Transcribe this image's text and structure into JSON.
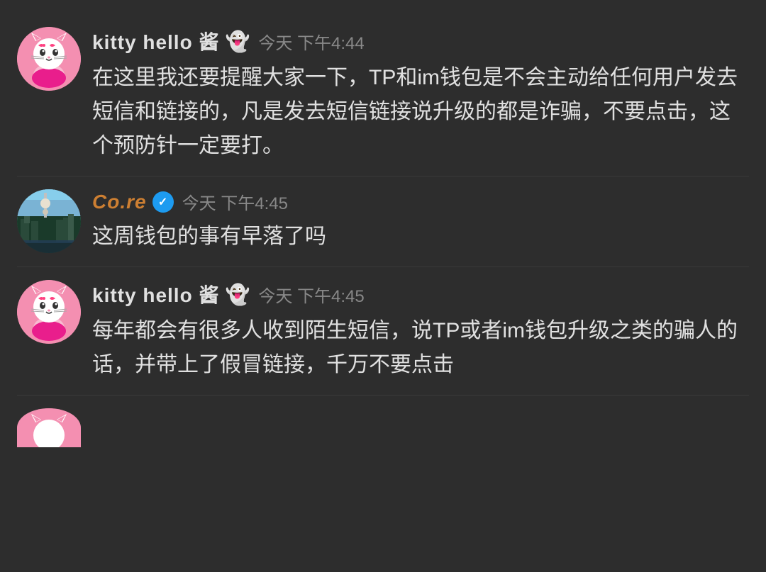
{
  "background": "#2d2d2d",
  "messages": [
    {
      "id": "msg1",
      "username": "kitty  hello  酱",
      "username_color": "#e0e0e0",
      "badge": "ghost",
      "timestamp": "今天 下午4:44",
      "text": "在这里我还要提醒大家一下，TP和im钱包是不会主动给任何用户发去短信和链接的，凡是发去短信链接说升级的都是诈骗，不要点击，这个预防针一定要打。",
      "avatar_type": "kitty"
    },
    {
      "id": "msg2",
      "username": "Co.re",
      "username_color": "#cd7f32",
      "badge": "verified",
      "timestamp": "今天 下午4:45",
      "text": "这周钱包的事有早落了吗",
      "avatar_type": "core"
    },
    {
      "id": "msg3",
      "username": "kitty  hello  酱",
      "username_color": "#e0e0e0",
      "badge": "ghost",
      "timestamp": "今天 下午4:45",
      "text": "每年都会有很多人收到陌生短信，说TP或者im钱包升级之类的骗人的话，并带上了假冒链接，千万不要点击",
      "avatar_type": "kitty"
    }
  ],
  "partial_message": {
    "avatar_type": "kitty"
  }
}
